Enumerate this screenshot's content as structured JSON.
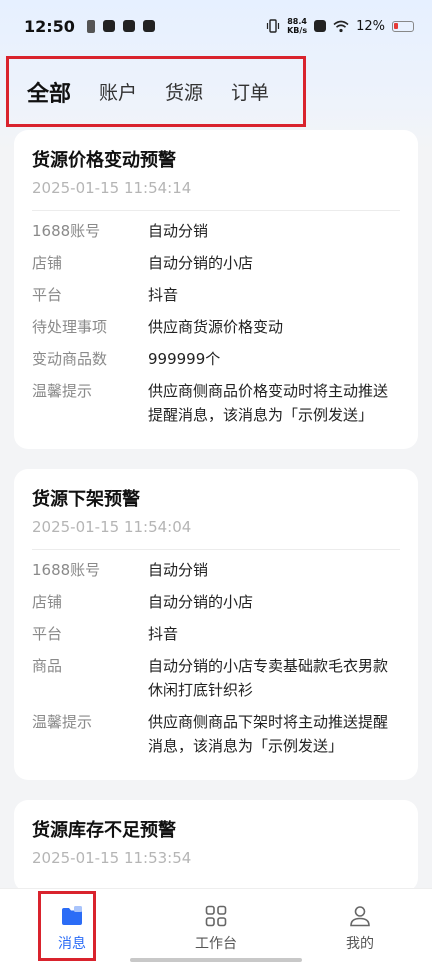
{
  "status_bar": {
    "time": "12:50",
    "net_speed_value": "88.4",
    "net_speed_unit": "KB/s",
    "battery": "12%"
  },
  "tabs": [
    {
      "label": "全部",
      "active": true
    },
    {
      "label": "账户",
      "active": false
    },
    {
      "label": "货源",
      "active": false
    },
    {
      "label": "订单",
      "active": false
    }
  ],
  "cards": [
    {
      "title": "货源价格变动预警",
      "time": "2025-01-15 11:54:14",
      "rows": [
        {
          "label": "1688账号",
          "value": "自动分销"
        },
        {
          "label": "店铺",
          "value": "自动分销的小店"
        },
        {
          "label": "平台",
          "value": "抖音"
        },
        {
          "label": "待处理事项",
          "value": "供应商货源价格变动"
        },
        {
          "label": "变动商品数",
          "value": "999999个"
        },
        {
          "label": "温馨提示",
          "value": "供应商侧商品价格变动时将主动推送提醒消息，该消息为「示例发送」"
        }
      ]
    },
    {
      "title": "货源下架预警",
      "time": "2025-01-15 11:54:04",
      "rows": [
        {
          "label": "1688账号",
          "value": "自动分销"
        },
        {
          "label": "店铺",
          "value": "自动分销的小店"
        },
        {
          "label": "平台",
          "value": "抖音"
        },
        {
          "label": "商品",
          "value": "自动分销的小店专卖基础款毛衣男款休闲打底针织衫"
        },
        {
          "label": "温馨提示",
          "value": "供应商侧商品下架时将主动推送提醒消息，该消息为「示例发送」"
        }
      ]
    },
    {
      "title": "货源库存不足预警",
      "time": "2025-01-15 11:53:54"
    }
  ],
  "bottom_nav": [
    {
      "label": "消息",
      "icon": "message-folder-icon",
      "active": true
    },
    {
      "label": "工作台",
      "icon": "grid-icon",
      "active": false
    },
    {
      "label": "我的",
      "icon": "person-icon",
      "active": false
    }
  ],
  "colors": {
    "accent": "#2b6cf6",
    "highlight": "#d9232d"
  }
}
